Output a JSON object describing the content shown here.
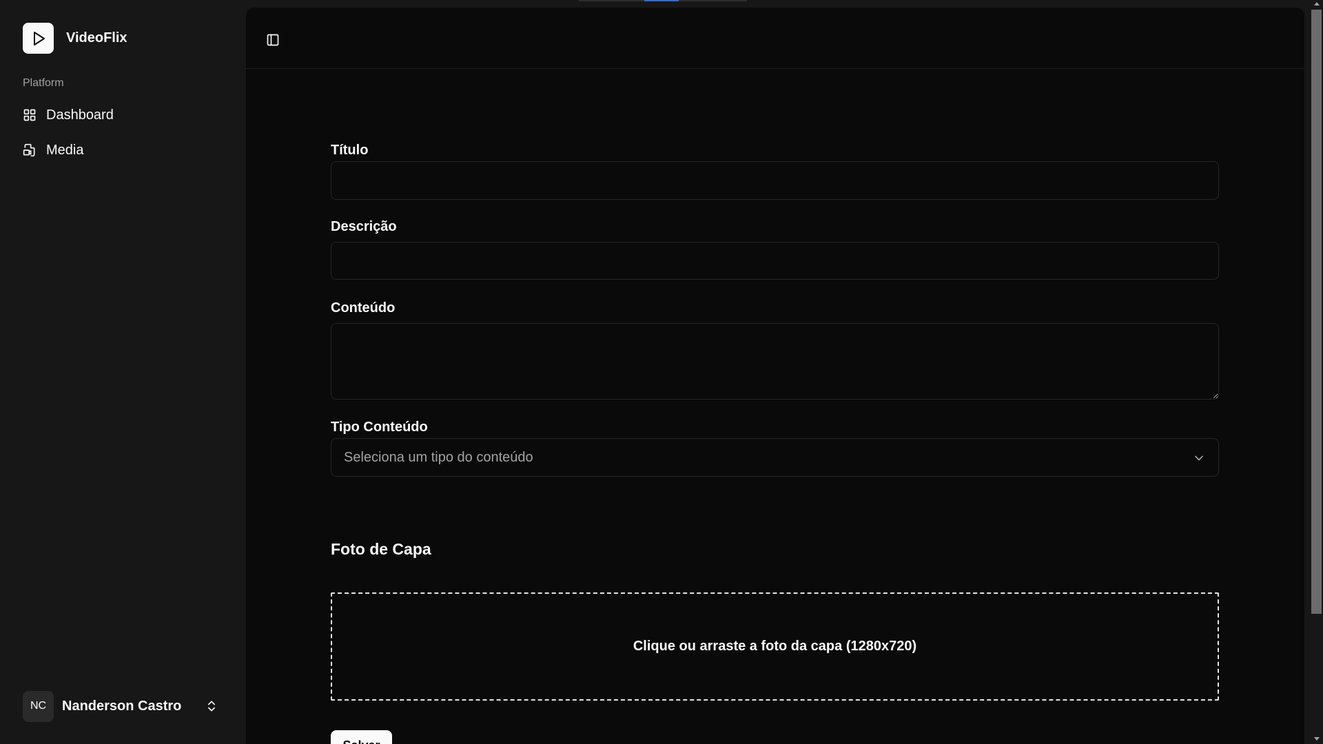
{
  "sidebar": {
    "brand": {
      "name": "VideoFlix",
      "logo_icon": "play-icon"
    },
    "group_label": "Platform",
    "items": [
      {
        "label": "Dashboard",
        "icon": "grid-icon"
      },
      {
        "label": "Media",
        "icon": "media-file-icon"
      }
    ],
    "user": {
      "initials": "NC",
      "name": "Nanderson Castro",
      "icon": "chevrons-up-down-icon"
    }
  },
  "header": {
    "toggle_icon": "panel-left-icon"
  },
  "form": {
    "titulo": {
      "label": "Título",
      "value": ""
    },
    "descricao": {
      "label": "Descrição",
      "value": ""
    },
    "conteudo": {
      "label": "Conteúdo",
      "value": ""
    },
    "tipo": {
      "label": "Tipo Conteúdo",
      "placeholder": "Seleciona um tipo do conteúdo",
      "icon": "chevron-down-icon"
    },
    "cover": {
      "title": "Foto de Capa",
      "dropzone_text": "Clique ou arraste a foto da capa (1280x720)"
    },
    "submit_label": "Salvar"
  },
  "colors": {
    "background": "#171717",
    "panel": "#0a0a0a",
    "foreground": "#fafafa",
    "muted": "#a3a3a3",
    "border": "#262626",
    "accent": "#2b6cdf"
  }
}
